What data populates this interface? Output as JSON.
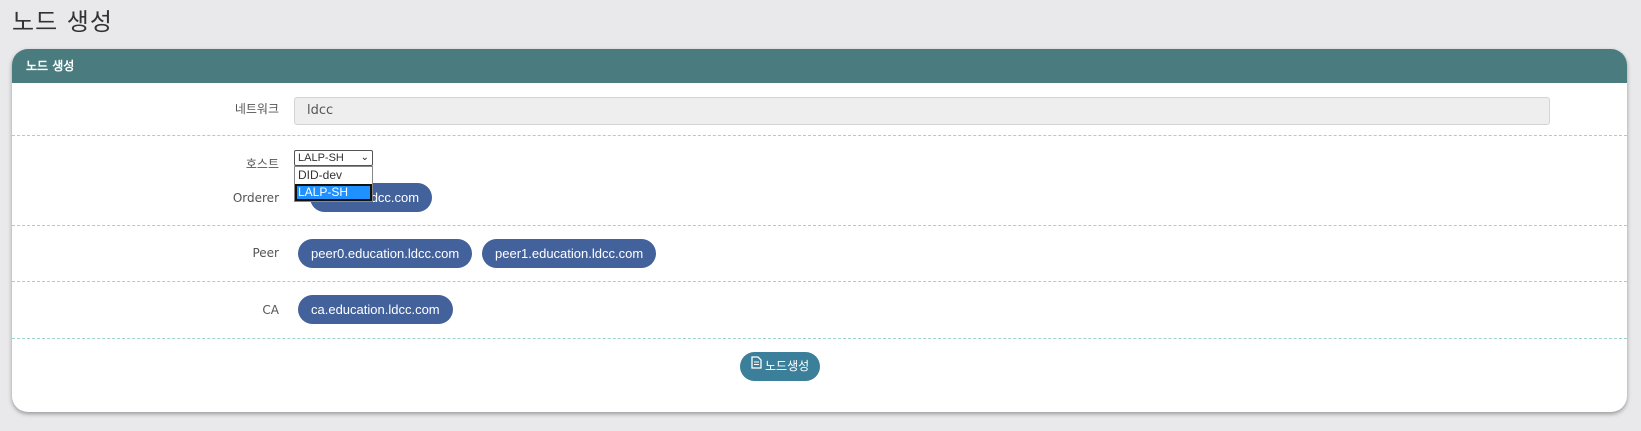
{
  "page": {
    "title": "노드 생성"
  },
  "card": {
    "header": "노드 생성",
    "network": {
      "label": "네트워크",
      "value": "ldcc"
    },
    "host": {
      "label": "호스트",
      "selected": "LALP-SH",
      "options": [
        "DID-dev",
        "LALP-SH"
      ]
    },
    "orderer": {
      "label": "Orderer",
      "nodes": [
        "orderer.ldcc.com"
      ]
    },
    "peer": {
      "label": "Peer",
      "nodes": [
        "peer0.education.ldcc.com",
        "peer1.education.ldcc.com"
      ]
    },
    "ca": {
      "label": "CA",
      "nodes": [
        "ca.education.ldcc.com"
      ]
    },
    "create_button": {
      "label": "노드생성",
      "icon": "file-icon"
    }
  },
  "colors": {
    "header": "#4a7b7f",
    "pill": "#43619a",
    "button": "#3b7f9a"
  }
}
